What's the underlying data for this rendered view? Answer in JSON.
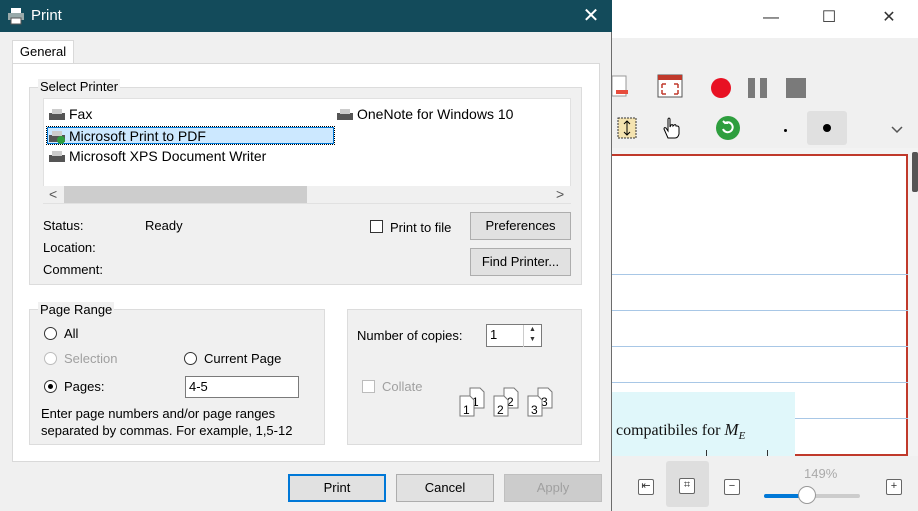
{
  "background_app": {
    "window_controls": {
      "minimize": "—",
      "maximize": "☐",
      "close": "✕"
    },
    "document_text": "compatibiles for",
    "document_math": "M",
    "document_math_sub": "E",
    "zoom_level": "149%",
    "zoom_fraction": 0.45
  },
  "dialog": {
    "title": "Print",
    "close_glyph": "✕",
    "tab_general": "General",
    "select_printer": {
      "label": "Select Printer",
      "printers": [
        "Fax",
        "OneNote for Windows 10",
        "Microsoft Print to PDF",
        "Microsoft XPS Document Writer"
      ],
      "selected": "Microsoft Print to PDF",
      "scroll_left": "<",
      "scroll_right": ">"
    },
    "status_label": "Status:",
    "status_value": "Ready",
    "location_label": "Location:",
    "comment_label": "Comment:",
    "print_to_file_label": "Print to file",
    "preferences_button": "Preferences",
    "find_printer_button": "Find Printer...",
    "page_range": {
      "label": "Page Range",
      "all": "All",
      "selection": "Selection",
      "current_page": "Current Page",
      "pages": "Pages:",
      "pages_value": "4-5",
      "hint_line1": "Enter page numbers and/or page ranges",
      "hint_line2": "separated by commas.  For example, 1,5-12"
    },
    "copies": {
      "label": "Number of copies:",
      "value": "1",
      "collate": "Collate"
    },
    "buttons": {
      "print": "Print",
      "cancel": "Cancel",
      "apply": "Apply"
    }
  },
  "colors": {
    "titlebar": "#134b5b",
    "accent": "#0078d7",
    "record_red": "#e81123",
    "page_border": "#c0392b"
  }
}
